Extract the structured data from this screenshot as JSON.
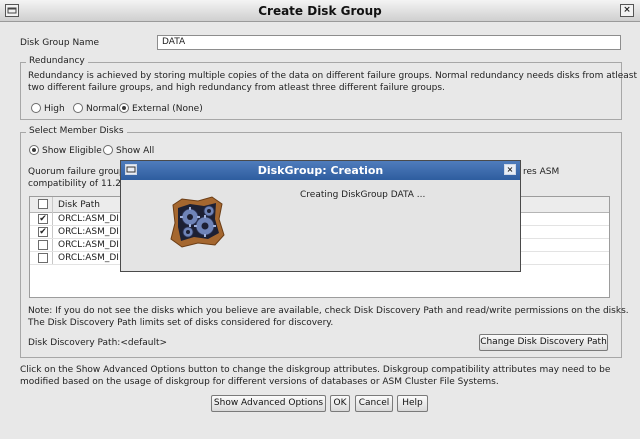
{
  "window": {
    "title": "Create Disk Group",
    "menu_icon": "window-menu-icon",
    "close_glyph": "×"
  },
  "disk_group_name": {
    "label": "Disk Group Name",
    "value": "DATA"
  },
  "redundancy": {
    "legend": "Redundancy",
    "description_line1": "Redundancy is achieved by storing multiple copies of the data on different failure groups. Normal redundancy needs disks from atleast",
    "description_line2": "two different failure groups, and high redundancy from atleast three different failure groups.",
    "options": [
      "High",
      "Normal",
      "External (None)"
    ],
    "selected": "External (None)"
  },
  "member_disks": {
    "legend": "Select Member Disks",
    "show_options": [
      "Show Eligible",
      "Show All"
    ],
    "selected": "Show Eligible",
    "quorum_line1_left": "Quorum failure group",
    "quorum_line1_right": "res ASM",
    "quorum_line2_left": "compatibility of 11.2",
    "table": {
      "column_header": "Disk Path",
      "rows": [
        {
          "path": "ORCL:ASM_DI",
          "checked": true
        },
        {
          "path": "ORCL:ASM_DI",
          "checked": true
        },
        {
          "path": "ORCL:ASM_DI",
          "checked": false
        },
        {
          "path": "ORCL:ASM_DI",
          "checked": false
        }
      ]
    },
    "note_line1": "Note: If you do not see the disks which you believe are available, check Disk Discovery Path and read/write permissions on the disks.",
    "note_line2": "The Disk Discovery Path limits set of disks considered for discovery.",
    "discovery_path_label": "Disk Discovery Path:<default>",
    "change_path_button": "Change Disk Discovery Path"
  },
  "footer": {
    "info_line1": "Click on the Show Advanced Options button to change the diskgroup attributes. Diskgroup compatibility attributes may need to be",
    "info_line2": "modified based on the usage of diskgroup for different versions of databases or ASM Cluster File Systems.",
    "buttons": {
      "advanced": "Show Advanced Options",
      "ok": "OK",
      "cancel": "Cancel",
      "help": "Help"
    }
  },
  "progress_dialog": {
    "title": "DiskGroup: Creation",
    "message": "Creating DiskGroup DATA ...",
    "close_glyph": "×",
    "image_icon": "gears-progress-icon"
  },
  "colors": {
    "dialog_titlebar": "#3a68aa",
    "window_bg": "#e8e8e8"
  }
}
